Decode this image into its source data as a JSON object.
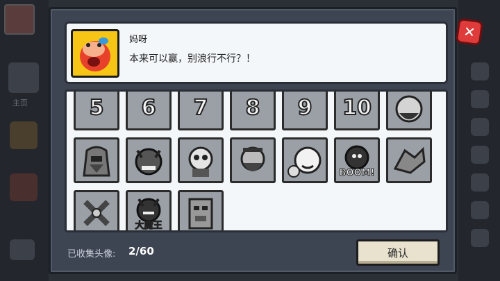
{
  "background": {
    "side_label": "主页"
  },
  "dialog": {
    "speaker_name": "妈呀",
    "speech_text": "本来可以赢，别浪行不行？！",
    "portrait_icon": "pig-face-portrait",
    "avatars": [
      {
        "label": "5",
        "icon": "level-5-badge",
        "unlocked": false
      },
      {
        "label": "6",
        "icon": "level-6-badge",
        "unlocked": false
      },
      {
        "label": "7",
        "icon": "level-7-badge",
        "unlocked": false
      },
      {
        "label": "8",
        "icon": "level-8-badge",
        "unlocked": false
      },
      {
        "label": "9",
        "icon": "level-9-badge",
        "unlocked": false
      },
      {
        "label": "10",
        "icon": "level-10-badge",
        "unlocked": false
      },
      {
        "label": "",
        "icon": "pirate-avatar",
        "unlocked": false
      },
      {
        "label": "",
        "icon": "hooded-knight-avatar",
        "unlocked": false
      },
      {
        "label": "",
        "icon": "horned-demon-avatar",
        "unlocked": false
      },
      {
        "label": "",
        "icon": "skull-warrior-avatar",
        "unlocked": false
      },
      {
        "label": "",
        "icon": "bearded-villain-avatar",
        "unlocked": false
      },
      {
        "label": "",
        "icon": "chubby-hero-avatar",
        "unlocked": false
      },
      {
        "label": "BOOM!",
        "icon": "bomb-avatar",
        "unlocked": false
      },
      {
        "label": "",
        "icon": "gauntlet-avatar",
        "unlocked": false
      },
      {
        "label": "",
        "icon": "crossed-axes-avatar",
        "unlocked": false
      },
      {
        "label": "大魔王",
        "icon": "demon-king-avatar",
        "unlocked": false
      },
      {
        "label": "",
        "icon": "totem-mask-avatar",
        "unlocked": false
      }
    ],
    "collected_label": "已收集头像:",
    "collected_count": "2/60",
    "confirm_label": "确认",
    "close_icon": "close-x-icon"
  }
}
